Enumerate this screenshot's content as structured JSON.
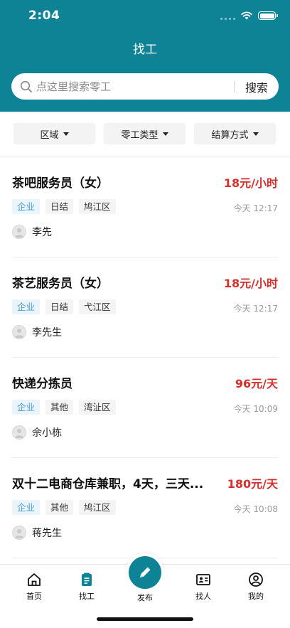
{
  "status_bar": {
    "time": "2:04"
  },
  "page_title": "找工",
  "search": {
    "placeholder": "点这里搜索零工",
    "button_label": "搜索"
  },
  "filters": [
    {
      "label": "区域"
    },
    {
      "label": "零工类型"
    },
    {
      "label": "结算方式"
    }
  ],
  "jobs": [
    {
      "title": "茶吧服务员（女）",
      "pay": "18元/小时",
      "tags": [
        "企业",
        "日结",
        "鸠江区"
      ],
      "time": "今天 12:17",
      "poster": "李先"
    },
    {
      "title": "茶艺服务员（女）",
      "pay": "18元/小时",
      "tags": [
        "企业",
        "日结",
        "弋江区"
      ],
      "time": "今天 12:17",
      "poster": "李先生"
    },
    {
      "title": "快递分拣员",
      "pay": "96元/天",
      "tags": [
        "企业",
        "其他",
        "湾沚区"
      ],
      "time": "今天 10:09",
      "poster": "佘小栋"
    },
    {
      "title": "双十二电商仓库兼职，4天，三天...",
      "pay": "180元/天",
      "tags": [
        "企业",
        "其他",
        "鸠江区"
      ],
      "time": "今天 10:08",
      "poster": "蒋先生"
    }
  ],
  "tabbar": {
    "home": "首页",
    "find_work": "找工",
    "publish": "发布",
    "find_people": "找人",
    "mine": "我的"
  },
  "colors": {
    "brand": "#0f8396",
    "pay_red": "#d4302b",
    "corp_tag_text": "#4a9bd0",
    "corp_tag_bg": "#e9f4fb"
  }
}
